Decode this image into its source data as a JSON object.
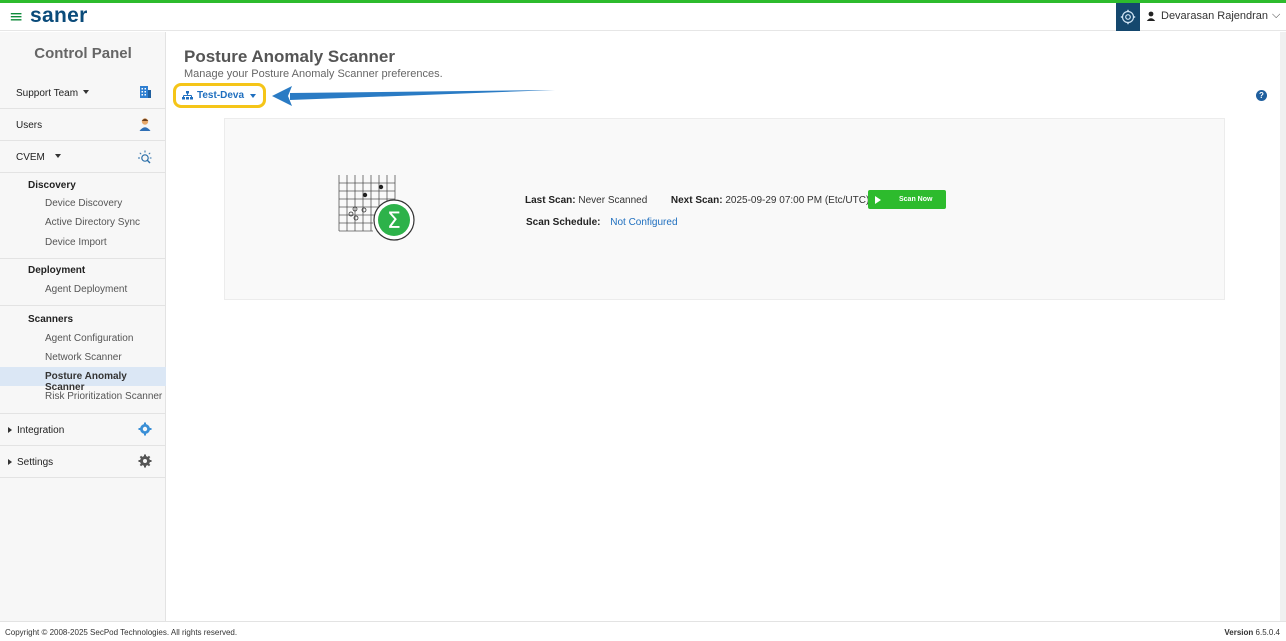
{
  "header": {
    "brand": "saner",
    "user_name": "Devarasan Rajendran",
    "menu_glyph": "≡",
    "chevron_glyph": "⌵"
  },
  "sidebar": {
    "title": "Control Panel",
    "rows": {
      "support_team": "Support Team",
      "users": "Users",
      "cvem": "CVEM",
      "integration": "Integration",
      "settings": "Settings"
    },
    "sections": {
      "discovery": {
        "title": "Discovery",
        "items": [
          "Device Discovery",
          "Active Directory Sync",
          "Device Import"
        ]
      },
      "deployment": {
        "title": "Deployment",
        "items": [
          "Agent Deployment"
        ]
      },
      "scanners": {
        "title": "Scanners",
        "items": [
          "Agent Configuration",
          "Network Scanner",
          "Posture Anomaly Scanner",
          "Risk Prioritization Scanner"
        ],
        "active": "Posture Anomaly Scanner"
      }
    }
  },
  "main": {
    "title": "Posture Anomaly Scanner",
    "subtitle": "Manage your Posture Anomaly Scanner preferences.",
    "scope_label": "Test-Deva",
    "help_glyph": "?",
    "scan": {
      "last_scan_label": "Last Scan:",
      "last_scan_value": "Never Scanned",
      "next_scan_label": "Next Scan:",
      "next_scan_value": "2025-09-29 07:00 PM (Etc/UTC)",
      "schedule_label": "Scan Schedule:",
      "schedule_value": "Not Configured",
      "button_label": "Scan Now"
    }
  },
  "footer": {
    "copyright": "Copyright © 2008-2025 SecPod Technologies. All rights reserved.",
    "version_label": "Version",
    "version_value": "6.5.0.4"
  },
  "colors": {
    "accent_green": "#2dbb2d",
    "brand_blue": "#0a4b7a",
    "link_blue": "#1f6fbf",
    "highlight_yellow": "#f5c518",
    "arrow_blue": "#2a7bc4"
  },
  "icons": {
    "menu": "hamburger-icon",
    "settings_gear": "gear-icon",
    "user": "user-icon",
    "support_team": "building-icon",
    "users": "person-icon",
    "cvem": "scan-bug-icon",
    "integration": "integration-gear-icon",
    "settings": "settings-gear-icon",
    "scope": "org-chart-icon",
    "help": "help-icon",
    "play": "play-icon",
    "illustration": "anomaly-sigma-icon"
  }
}
